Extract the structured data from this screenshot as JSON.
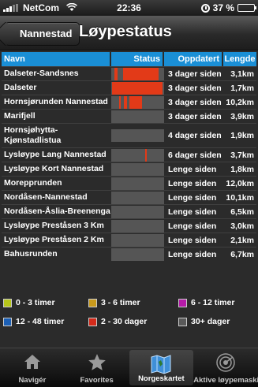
{
  "statusbar": {
    "carrier": "NetCom",
    "time": "22:36",
    "battery": "37 %"
  },
  "navbar": {
    "back_label": "Nannestad",
    "title": "Løypestatus"
  },
  "table": {
    "headers": {
      "navn": "Navn",
      "status": "Status",
      "oppdatert": "Oppdatert",
      "lengde": "Lengde"
    },
    "rows": [
      {
        "navn": "Dalseter-Sandsnes",
        "oppdatert": "3 dager siden",
        "lengde": "3,1km",
        "status_fill": [
          [
            0.06,
            0.12
          ],
          [
            0.22,
            0.9
          ]
        ]
      },
      {
        "navn": "Dalseter",
        "oppdatert": "3 dager siden",
        "lengde": "1,7km",
        "status_fill": [
          [
            0.02,
            0.97
          ]
        ]
      },
      {
        "navn": "Hornsjørunden Nannestad",
        "oppdatert": "3 dager siden",
        "lengde": "10,2km",
        "status_fill": [
          [
            0.15,
            0.18
          ],
          [
            0.24,
            0.3
          ],
          [
            0.35,
            0.58
          ]
        ]
      },
      {
        "navn": "Marifjell",
        "oppdatert": "3 dager siden",
        "lengde": "3,9km",
        "status_fill": []
      },
      {
        "navn": "Hornsjøhytta-Kjønstadlistua",
        "oppdatert": "4 dager siden",
        "lengde": "1,9km",
        "status_fill": []
      },
      {
        "navn": "Lysløype Lang Nannestad",
        "oppdatert": "6 dager siden",
        "lengde": "3,7km",
        "status_fill": [
          [
            0.64,
            0.67
          ]
        ]
      },
      {
        "navn": "Lysløype Kort Nannestad",
        "oppdatert": "Lenge siden",
        "lengde": "1,8km",
        "status_fill": []
      },
      {
        "navn": "Morepprunden",
        "oppdatert": "Lenge siden",
        "lengde": "12,0km",
        "status_fill": []
      },
      {
        "navn": "Nordåsen-Nannestad",
        "oppdatert": "Lenge siden",
        "lengde": "10,1km",
        "status_fill": []
      },
      {
        "navn": "Nordåsen-Åslia-Breenenga",
        "oppdatert": "Lenge siden",
        "lengde": "6,5km",
        "status_fill": []
      },
      {
        "navn": "Lysløype Preståsen 3 Km",
        "oppdatert": "Lenge siden",
        "lengde": "3,0km",
        "status_fill": []
      },
      {
        "navn": "Lysløype Preståsen 2 Km",
        "oppdatert": "Lenge siden",
        "lengde": "2,1km",
        "status_fill": []
      },
      {
        "navn": "Bahusrunden",
        "oppdatert": "Lenge siden",
        "lengde": "6,7km",
        "status_fill": []
      }
    ]
  },
  "legend": [
    [
      {
        "label": "0 - 3 timer",
        "color": "#b6c61b"
      },
      {
        "label": "3 - 6 timer",
        "color": "#c99a1c"
      },
      {
        "label": "6 - 12 timer",
        "color": "#b51aa8"
      }
    ],
    [
      {
        "label": "12 - 48 timer",
        "color": "#1b5fb5"
      },
      {
        "label": "2 - 30 dager",
        "color": "#d42a1a"
      },
      {
        "label": "30+ dager",
        "color": "#5a5a5a"
      }
    ]
  ],
  "tabs": [
    {
      "label": "Navigér",
      "icon": "home-icon",
      "active": false
    },
    {
      "label": "Favorites",
      "icon": "star-icon",
      "active": false
    },
    {
      "label": "Norgeskartet",
      "icon": "map-icon",
      "active": true
    },
    {
      "label": "Aktive løypemaskiner",
      "icon": "radar-icon",
      "active": false
    }
  ]
}
